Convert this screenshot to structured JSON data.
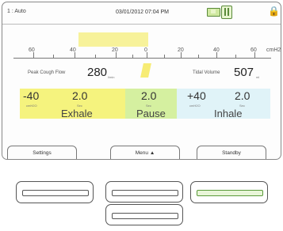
{
  "status": {
    "mode": "1 : Auto",
    "datetime": "03/01/2012 07:04 PM",
    "battery_icon": "battery-icon",
    "plug_icon": "ac-power-icon",
    "lock_icon": "lock-icon"
  },
  "pressure": {
    "bar_text": "",
    "scale_ticks": [
      "60",
      "40",
      "20",
      "0",
      "20",
      "40",
      "60"
    ],
    "unit": "cmH20"
  },
  "readouts": {
    "peak_cough_flow": {
      "label": "Peak Cough Flow",
      "value": "280",
      "unit": "l/min"
    },
    "tidal_volume": {
      "label": "Tidal Volume",
      "value": "507",
      "unit": "ml"
    }
  },
  "phases": {
    "exhale": {
      "pressure": "-40",
      "pressure_unit": "cmH2O",
      "time": "2.0",
      "time_unit": "Sec",
      "name": "Exhale",
      "color": "#f5f37e"
    },
    "pause": {
      "time": "2.0",
      "time_unit": "Sec",
      "name": "Pause",
      "color": "#d5f0a0"
    },
    "inhale": {
      "pressure": "+40",
      "pressure_unit": "cmH2O",
      "time": "2.0",
      "time_unit": "Sec",
      "name": "Inhale",
      "color": "#e0f3f8"
    }
  },
  "buttons": {
    "settings": "Settings",
    "menu": "Menu ▲",
    "standby": "Standby"
  }
}
